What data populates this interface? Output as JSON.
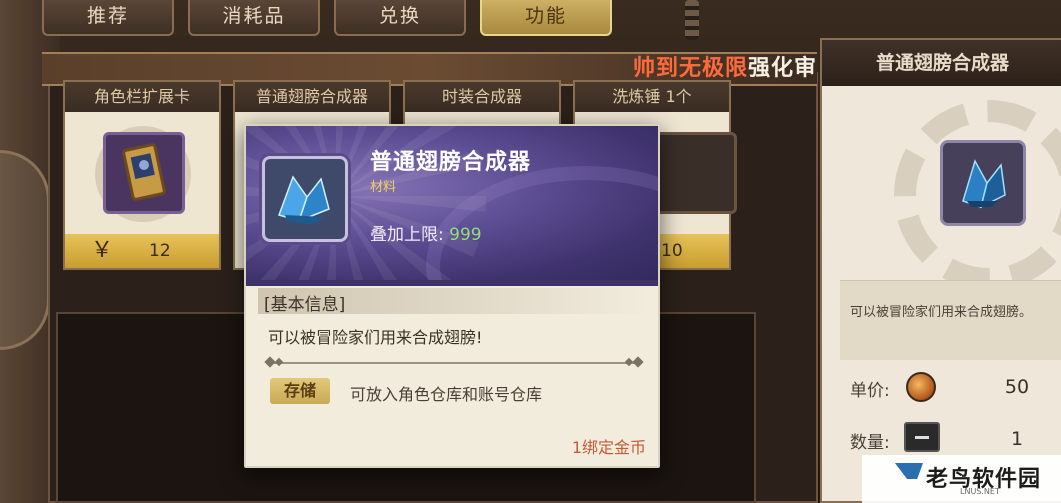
{
  "tabs": [
    {
      "label": "推荐",
      "active": false
    },
    {
      "label": "消耗品",
      "active": false
    },
    {
      "label": "兑换",
      "active": false
    },
    {
      "label": "功能",
      "active": true
    }
  ],
  "banner": {
    "highlight": "帅到无极限",
    "rest": "强化审"
  },
  "shop_cards": [
    {
      "title": "角色栏扩展卡",
      "currency": "￥",
      "price": "12",
      "icon": "expansion-card-icon"
    },
    {
      "title": "普通翅膀合成器",
      "icon": "crystal-icon"
    },
    {
      "title": "时装合成器",
      "icon": "fashion-synth-icon"
    },
    {
      "title": "洗炼锤 1个",
      "price": "10",
      "icon": "hammer-icon"
    }
  ],
  "detail": {
    "title": "普通翅膀合成器",
    "description": "可以被冒险家们用来合成翅膀。",
    "unit_price_label": "单价:",
    "unit_price_value": "50",
    "quantity_label": "数量:",
    "quantity_value": "1"
  },
  "tooltip": {
    "item_name": "普通翅膀合成器",
    "item_type": "材料",
    "stack_label": "叠加上限:",
    "stack_value": "999",
    "section_title": "[基本信息]",
    "description": "可以被冒险家们用来合成翅膀!",
    "storage_badge": "存储",
    "storage_text": "可放入角色仓库和账号仓库",
    "footer": "1绑定金币"
  },
  "watermark": {
    "text": "老鸟软件园",
    "sub": "LNUS.NET"
  },
  "colors": {
    "tooltip_header": "#5d4d93",
    "stack_value": "#8fe07a",
    "type_text": "#f0d060",
    "footer_text": "#c45a3a",
    "banner_highlight": "#ff6a3d",
    "price_bar": "#e7c35a"
  }
}
